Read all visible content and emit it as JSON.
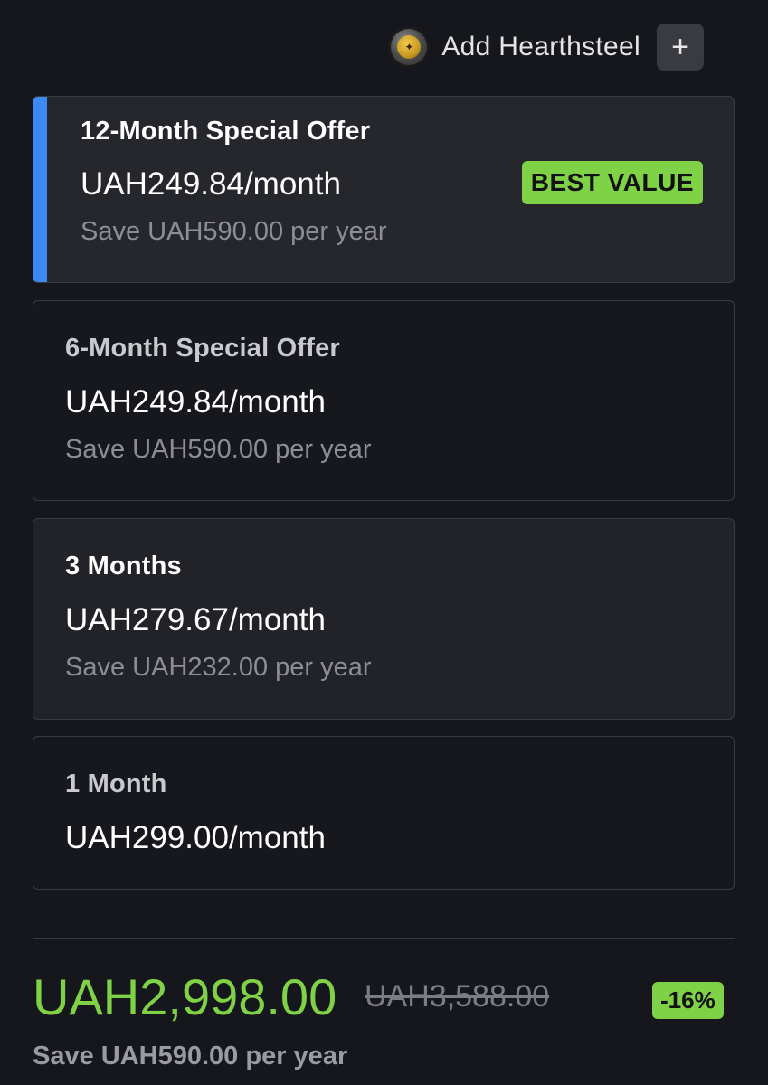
{
  "header": {
    "currency_icon": "hearthsteel-coin-icon",
    "add_label": "Add Hearthsteel",
    "plus_label": "+"
  },
  "plans": [
    {
      "title": "12-Month Special Offer",
      "price": "UAH249.84/month",
      "save": "Save UAH590.00 per year",
      "badge": "BEST VALUE",
      "selected": true
    },
    {
      "title": "6-Month Special Offer",
      "price": "UAH249.84/month",
      "save": "Save UAH590.00 per year"
    },
    {
      "title": "3 Months",
      "price": "UAH279.67/month",
      "save": "Save UAH232.00 per year"
    },
    {
      "title": "1 Month",
      "price": "UAH299.00/month"
    }
  ],
  "summary": {
    "total": "UAH2,998.00",
    "original": "UAH3,588.00",
    "discount": "-16%",
    "save": "Save UAH590.00 per year"
  },
  "colors": {
    "accent_blue": "#3b8af2",
    "accent_green": "#7fd146",
    "background": "#16171c"
  }
}
